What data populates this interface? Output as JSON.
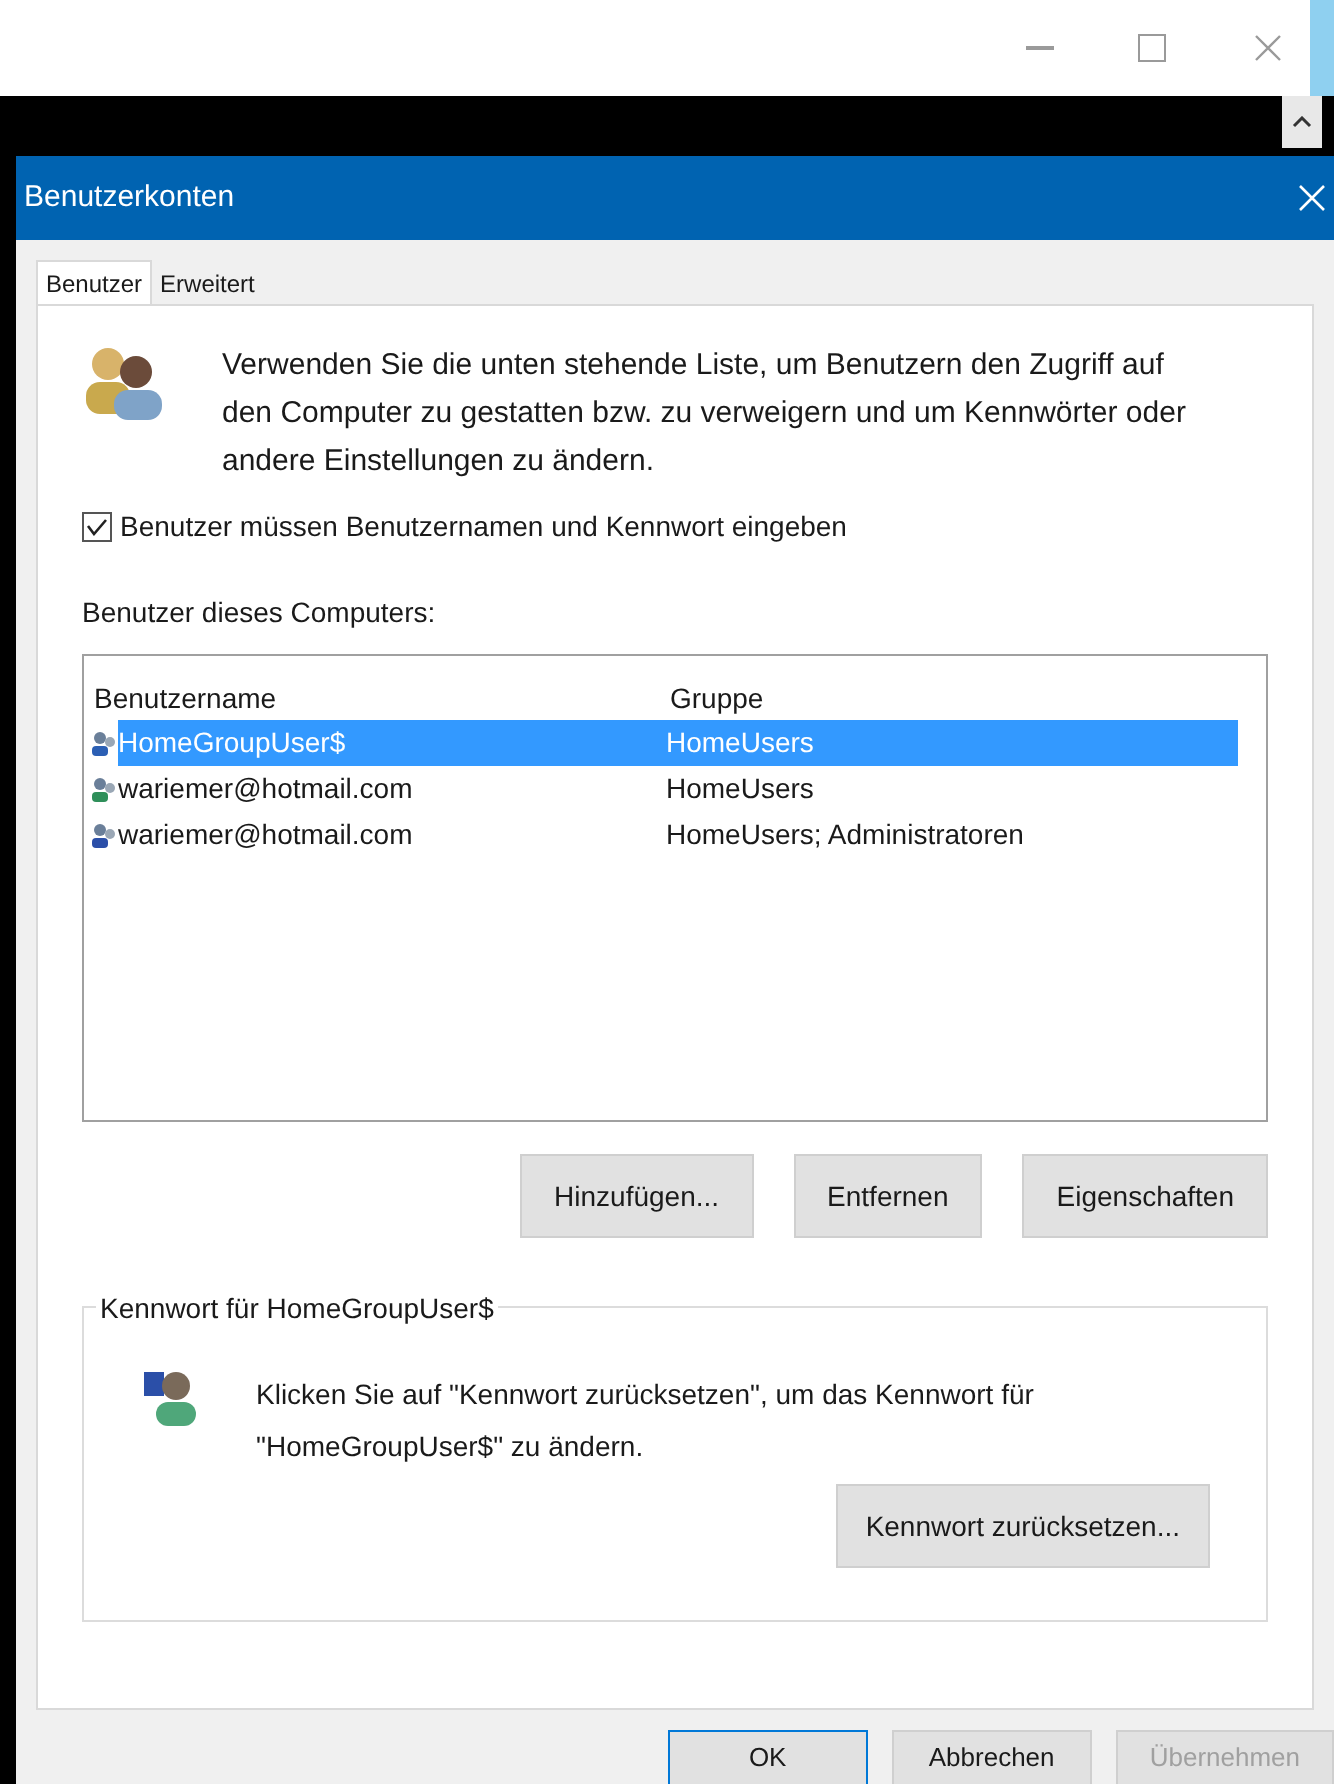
{
  "dialog": {
    "title": "Benutzerkonten"
  },
  "tabs": [
    {
      "label": "Benutzer",
      "selected": true
    },
    {
      "label": "Erweitert",
      "selected": false
    }
  ],
  "intro": "Verwenden Sie die unten stehende Liste, um Benutzern den Zugriff auf den Computer zu gestatten bzw. zu verweigern und um Kennwörter oder andere Einstellungen zu ändern.",
  "require_login": {
    "label": "Benutzer müssen Benutzernamen und Kennwort eingeben",
    "checked": true
  },
  "users_label": "Benutzer dieses Computers:",
  "table": {
    "columns": [
      "Benutzername",
      "Gruppe"
    ],
    "rows": [
      {
        "kind": "homegroup",
        "name": "HomeGroupUser$",
        "group": "HomeUsers",
        "selected": true
      },
      {
        "kind": "online",
        "name": "wariemer@hotmail.com",
        "group": "HomeUsers",
        "selected": false
      },
      {
        "kind": "local",
        "name": "wariemer@hotmail.com",
        "group": "HomeUsers; Administratoren",
        "selected": false
      }
    ]
  },
  "list_buttons": [
    "Hinzufügen...",
    "Entfernen",
    "Eigenschaften"
  ],
  "password_group": {
    "title": "Kennwort für HomeGroupUser$",
    "text": "Klicken Sie auf \"Kennwort zurücksetzen\", um das Kennwort für \"HomeGroupUser$\" zu ändern.",
    "button": "Kennwort zurücksetzen..."
  },
  "footer_buttons": [
    {
      "label": "OK",
      "disabled": false,
      "default": true
    },
    {
      "label": "Abbrechen",
      "disabled": false,
      "default": false
    },
    {
      "label": "Übernehmen",
      "disabled": true,
      "default": false
    }
  ]
}
